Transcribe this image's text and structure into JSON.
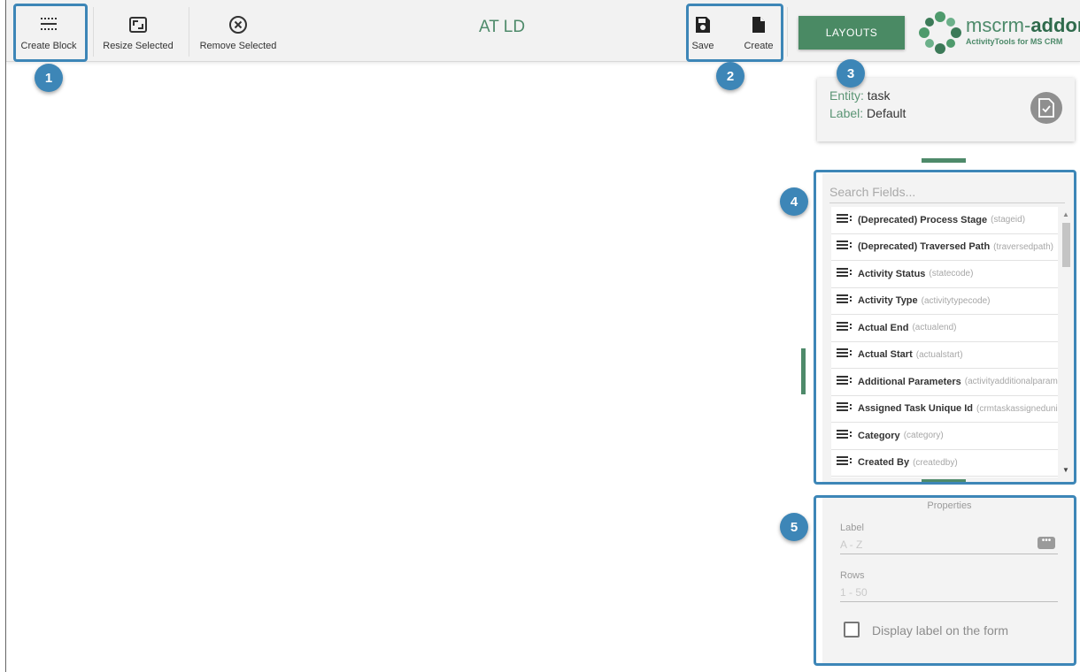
{
  "toolbar": {
    "create_block": "Create Block",
    "resize_selected": "Resize Selected",
    "remove_selected": "Remove Selected",
    "title": "AT LD",
    "save": "Save",
    "create": "Create",
    "layouts": "LAYOUTS"
  },
  "logo": {
    "name_prefix": "mscrm-",
    "name_bold": "addon",
    "tagline": "ActivityTools for MS CRM"
  },
  "entity": {
    "entity_label": "Entity:",
    "entity_value": "task",
    "label_label": "Label:",
    "label_value": "Default",
    "icon": "task-check-icon"
  },
  "fields": {
    "search_placeholder": "Search Fields...",
    "items": [
      {
        "name": "(Deprecated) Process Stage",
        "code": "(stageid)"
      },
      {
        "name": "(Deprecated) Traversed Path",
        "code": "(traversedpath)"
      },
      {
        "name": "Activity Status",
        "code": "(statecode)"
      },
      {
        "name": "Activity Type",
        "code": "(activitytypecode)"
      },
      {
        "name": "Actual End",
        "code": "(actualend)"
      },
      {
        "name": "Actual Start",
        "code": "(actualstart)"
      },
      {
        "name": "Additional Parameters",
        "code": "(activityadditionalparams)"
      },
      {
        "name": "Assigned Task Unique Id",
        "code": "(crmtaskassigneduniqueid)"
      },
      {
        "name": "Category",
        "code": "(category)"
      },
      {
        "name": "Created By",
        "code": "(createdby)"
      }
    ]
  },
  "properties": {
    "title": "Properties",
    "label_caption": "Label",
    "label_placeholder": "A - Z",
    "rows_caption": "Rows",
    "rows_placeholder": "1 - 50",
    "display_label": "Display label on the form",
    "display_label_checked": false
  },
  "callouts": [
    "1",
    "2",
    "3",
    "4",
    "5"
  ],
  "colors": {
    "accent": "#4a8a64",
    "callout": "#3d86b7"
  }
}
